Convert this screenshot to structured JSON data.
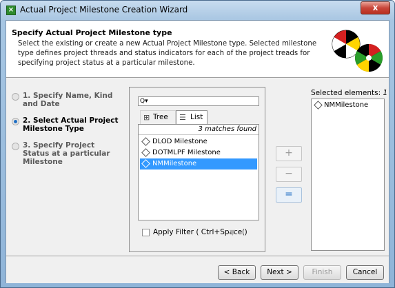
{
  "window": {
    "title": "Actual Project Milestone Creation Wizard",
    "close_glyph": "x"
  },
  "header": {
    "title": "Specify Actual Project Milestone type",
    "description": "Select the existing or create a new Actual Project Milestone type. Selected milestone type defines project threads and status indicators for each of the project treads for specifying project status at a particular milestone."
  },
  "steps": [
    {
      "label": "1. Specify Name, Kind and Date",
      "selected": false
    },
    {
      "label": "2. Select Actual Project Milestone Type",
      "selected": true
    },
    {
      "label": "3. Specify Project Status at a particular Milestone",
      "selected": false
    }
  ],
  "search": {
    "value": "",
    "icon_text": "Q▾"
  },
  "tabs": [
    {
      "label": "Tree",
      "icon": "tree-icon"
    },
    {
      "label": "List",
      "icon": "list-icon"
    }
  ],
  "list": {
    "match_count": "3 matches found",
    "items": [
      {
        "label": "DLOD Milestone",
        "selected": false
      },
      {
        "label": "DOTMLPF Milestone",
        "selected": false
      },
      {
        "label": "NMMilestone",
        "selected": true
      }
    ]
  },
  "filter": {
    "label": "Apply Filter ( Ctrl+Space )",
    "extra": "("
  },
  "controls": {
    "add": "+",
    "remove": "−",
    "equal": "="
  },
  "selected": {
    "label_prefix": "Selected elements: ",
    "count": "1",
    "items": [
      "NMMilestone"
    ]
  },
  "buttons": {
    "back": "< Back",
    "next": "Next >",
    "finish": "Finish",
    "cancel": "Cancel"
  },
  "colors": {
    "selection": "#3399ff",
    "accent": "#1f6fc4"
  }
}
